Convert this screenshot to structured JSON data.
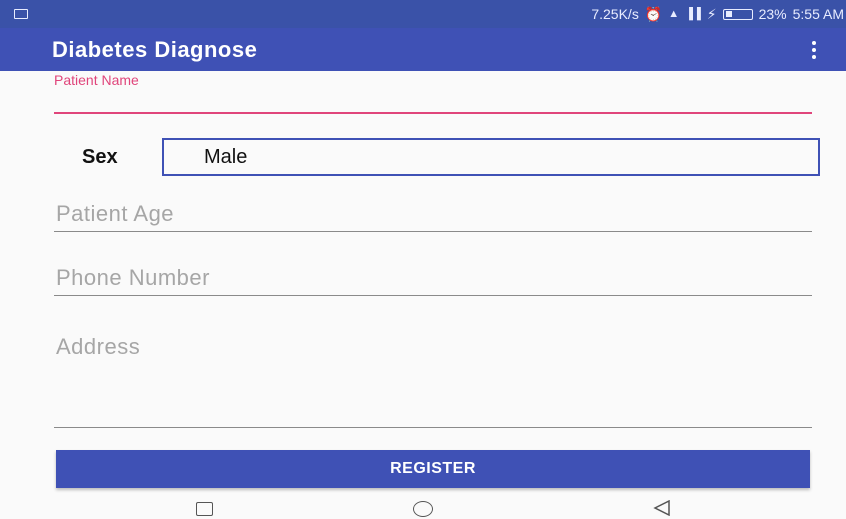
{
  "status_bar": {
    "network_speed": "7.25K/s",
    "battery_percent": "23%",
    "time": "5:55 AM",
    "icons": [
      "notification-icon",
      "alarm-icon",
      "wifi-signal-icon",
      "cell-signal-icon",
      "charging-icon",
      "battery-icon"
    ]
  },
  "app_bar": {
    "title": "Diabetes Diagnose",
    "menu_icon": "overflow-menu-icon"
  },
  "form": {
    "patient_name": {
      "label": "Patient Name",
      "value": ""
    },
    "sex": {
      "label": "Sex",
      "selected": "Male"
    },
    "patient_age": {
      "placeholder": "Patient Age",
      "value": ""
    },
    "phone_number": {
      "placeholder": "Phone Number",
      "value": ""
    },
    "address": {
      "placeholder": "Address",
      "value": ""
    },
    "register_label": "REGISTER"
  },
  "nav_bar": {
    "icons": [
      "recent-apps-icon",
      "home-icon",
      "back-icon"
    ]
  },
  "colors": {
    "primary": "#3f51b5",
    "status_bar": "#3a52a8",
    "accent": "#e0457b",
    "background": "#fafafa"
  }
}
